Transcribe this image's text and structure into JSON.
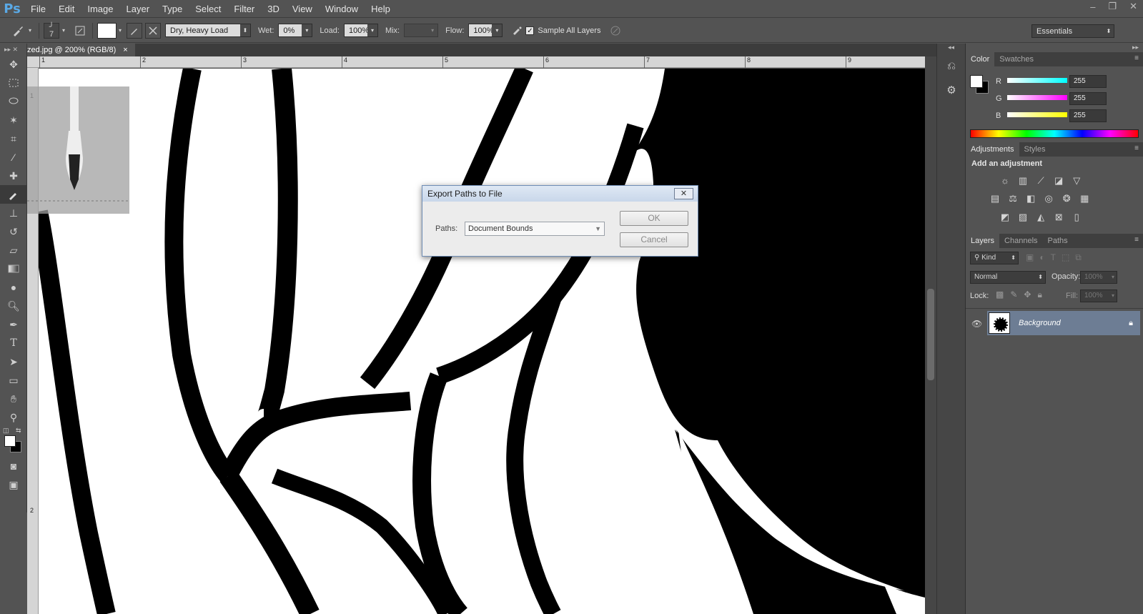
{
  "app": {
    "logo": "Ps"
  },
  "menu": [
    "File",
    "Edit",
    "Image",
    "Layer",
    "Type",
    "Select",
    "Filter",
    "3D",
    "View",
    "Window",
    "Help"
  ],
  "window_controls": {
    "minimize": "–",
    "restore": "❐",
    "close": "✕"
  },
  "options": {
    "brush_size": "7",
    "preset": "Dry, Heavy Load",
    "wet_label": "Wet:",
    "wet_value": "0%",
    "load_label": "Load:",
    "load_value": "100%",
    "mix_label": "Mix:",
    "mix_value": "",
    "flow_label": "Flow:",
    "flow_value": "100%",
    "sample_all_layers": "Sample All Layers",
    "workspace": "Essentials"
  },
  "document": {
    "tab_title": "zed.jpg @ 200% (RGB/8)",
    "tab_close": "×",
    "ruler_h": [
      "1",
      "2",
      "3",
      "4",
      "5",
      "6",
      "7",
      "8",
      "9"
    ],
    "ruler_v": [
      "1",
      "2"
    ]
  },
  "dialog": {
    "title": "Export Paths to File",
    "close": "✕",
    "paths_label": "Paths:",
    "paths_value": "Document Bounds",
    "ok": "OK",
    "cancel": "Cancel"
  },
  "color_panel": {
    "tabs": [
      "Color",
      "Swatches"
    ],
    "r_label": "R",
    "r_value": "255",
    "g_label": "G",
    "g_value": "255",
    "b_label": "B",
    "b_value": "255"
  },
  "adjustments_panel": {
    "tabs": [
      "Adjustments",
      "Styles"
    ],
    "heading": "Add an adjustment",
    "icons_row1": [
      "brightness-icon",
      "levels-icon",
      "curves-icon",
      "exposure-icon",
      "vibrance-icon"
    ],
    "icons_row2": [
      "hue-saturation-icon",
      "color-balance-icon",
      "black-white-icon",
      "photo-filter-icon",
      "channel-mixer-icon",
      "color-lookup-icon"
    ],
    "icons_row3": [
      "invert-icon",
      "posterize-icon",
      "threshold-icon",
      "selective-color-icon",
      "gradient-map-icon"
    ]
  },
  "layers_panel": {
    "tabs": [
      "Layers",
      "Channels",
      "Paths"
    ],
    "filter": "Kind",
    "blend_mode": "Normal",
    "opacity_label": "Opacity:",
    "opacity_value": "100%",
    "lock_label": "Lock:",
    "fill_label": "Fill:",
    "fill_value": "100%",
    "layer_name": "Background"
  },
  "colors": {
    "ui_bg": "#535353",
    "dialog_bg": "#ececec",
    "selected_layer": "#6d7d94",
    "r_slider": "#00e0e0",
    "g_slider": "#e000e0",
    "b_slider": "#e0e000"
  }
}
